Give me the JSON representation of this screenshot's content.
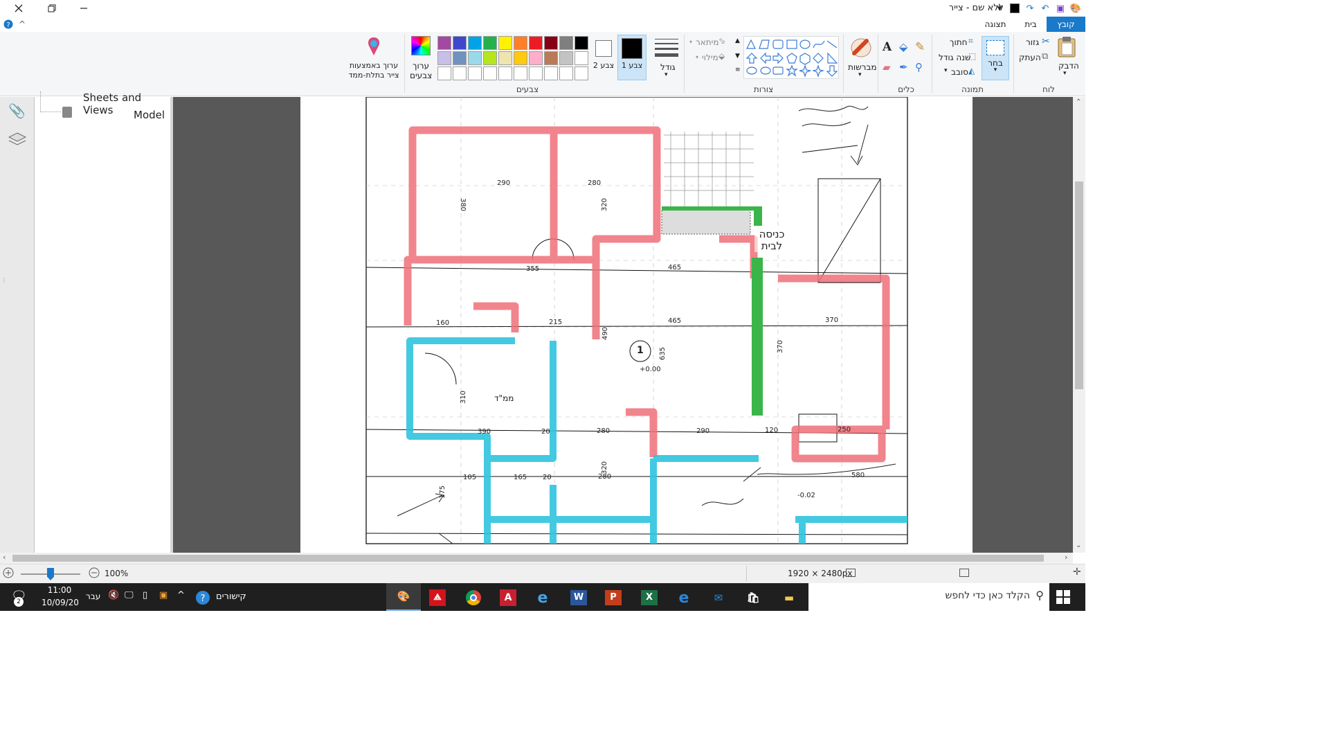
{
  "window": {
    "title": "ללא שם - צייר",
    "close_icon": "close-icon",
    "maximize_icon": "maximize-icon",
    "minimize_icon": "minimize-icon"
  },
  "tabs": [
    {
      "label": "קובץ",
      "active": true
    },
    {
      "label": "בית",
      "active": false
    },
    {
      "label": "תצוגה",
      "active": false
    }
  ],
  "ribbon": {
    "clipboard": {
      "label": "לוח",
      "paste": "הדבק",
      "cut": "גזור",
      "copy": "העתק"
    },
    "image": {
      "label": "תמונה",
      "select": "בחר",
      "crop": "חתוך",
      "resize": "שנה גודל",
      "rotate": "סובב"
    },
    "tools": {
      "label": "כלים"
    },
    "brushes": {
      "label": "מברשות"
    },
    "shapes": {
      "label": "צורות",
      "outline": "מיתאר",
      "fill": "מילוי"
    },
    "size": {
      "label": "גודל"
    },
    "colors": {
      "label": "צבעים",
      "color1": "צבע 1",
      "color2": "צבע 2",
      "edit_colors": "ערוך צבעים",
      "paint3d": "ערוך באמצעות צייר בתלת-ממד",
      "color1_value": "#000000",
      "color2_value": "#ffffff",
      "palette_row1": [
        "#000000",
        "#7f7f7f",
        "#880015",
        "#ed1c24",
        "#ff7f27",
        "#fff200",
        "#22b14c",
        "#00a2e8",
        "#3f48cc",
        "#a349a4"
      ],
      "palette_row2": [
        "#ffffff",
        "#c3c3c3",
        "#b97a57",
        "#ffaec9",
        "#ffc90e",
        "#efe4b0",
        "#b5e61d",
        "#99d9ea",
        "#7092be",
        "#c8bfe7"
      ]
    }
  },
  "navpane": {
    "item1": "Sheets and Views",
    "item2": "Model"
  },
  "plan": {
    "dims": [
      "290",
      "280",
      "380",
      "320",
      "355",
      "465",
      "465",
      "160",
      "215",
      "490",
      "635",
      "370",
      "370",
      "310",
      "390",
      "280",
      "290",
      "120",
      "250",
      "20",
      "105",
      "165",
      "175",
      "20",
      "320",
      "280",
      "580"
    ],
    "entrance_label": "כניסה לבית",
    "room_label": "ממ\"ד",
    "marker": "1",
    "level": "+0.00",
    "level2": "-0.02"
  },
  "statusbar": {
    "zoom": "100%",
    "dimensions": "1920 × 2480px"
  },
  "taskbar": {
    "search_placeholder": "הקלד כאן כדי לחפש",
    "time": "11:00",
    "date": "10/09/20",
    "lang": "עבר",
    "links": "קישורים",
    "notif_count": "2"
  }
}
